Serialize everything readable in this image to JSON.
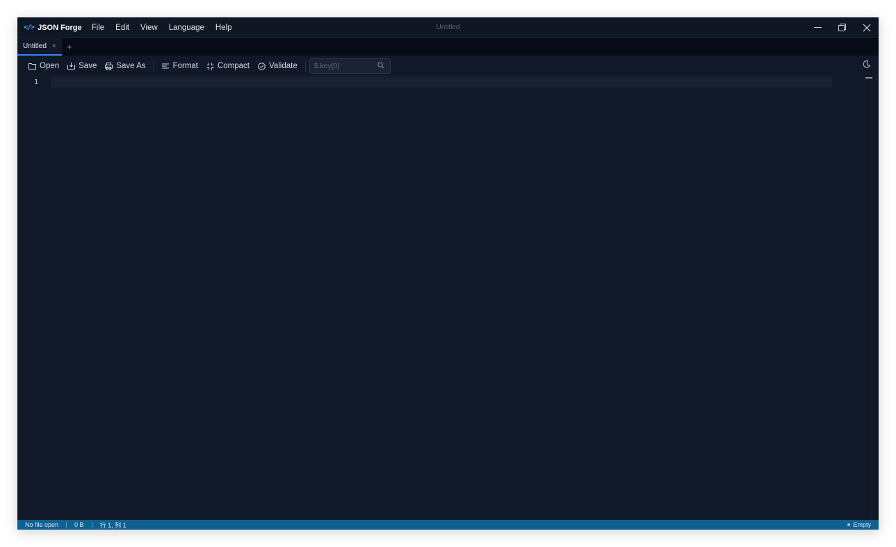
{
  "app": {
    "brand_icon": "</>",
    "name": "JSON Forge",
    "window_title": "Untitled",
    "accent_color": "#3b82f6"
  },
  "menu": {
    "items": [
      {
        "label": "File"
      },
      {
        "label": "Edit"
      },
      {
        "label": "View"
      },
      {
        "label": "Language"
      },
      {
        "label": "Help"
      }
    ]
  },
  "tabs": {
    "items": [
      {
        "label": "Untitled",
        "close": "×"
      }
    ],
    "add_label": "+"
  },
  "toolbar": {
    "open_label": "Open",
    "save_label": "Save",
    "save_as_label": "Save As",
    "format_label": "Format",
    "compact_label": "Compact",
    "validate_label": "Validate",
    "search_placeholder": "$.key[0]"
  },
  "editor": {
    "line_numbers": [
      "1"
    ]
  },
  "status": {
    "file": "No file open",
    "size": "0 B",
    "position": "行 1, 列 1",
    "state": "Empty",
    "bar_color": "#0e6191"
  }
}
